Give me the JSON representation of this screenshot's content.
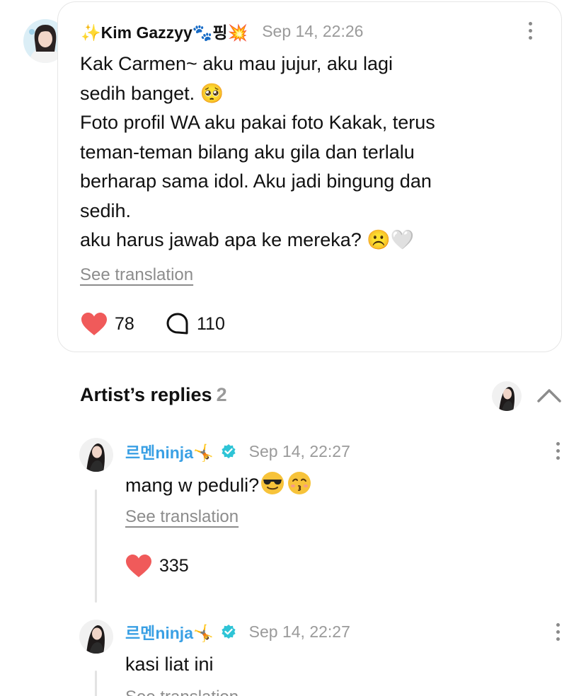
{
  "post": {
    "username": "✨Kim Gazzyy🐾핑💥",
    "timestamp": "Sep 14, 22:26",
    "body": "Kak Carmen~ aku mau jujur, aku lagi\nsedih banget. 🥺\nFoto profil WA aku pakai foto Kakak, terus\nteman-teman bilang aku gila dan terlalu\nberharap sama idol. Aku jadi bingung dan\nsedih.\naku harus jawab apa ke mereka? ☹️🤍",
    "see_translation": "See translation",
    "likes": "78",
    "comments": "110"
  },
  "replies_section": {
    "title": "Artist’s replies",
    "count": "2"
  },
  "replies": [
    {
      "username": "르멘ninja🤸",
      "timestamp": "Sep 14, 22:27",
      "text": "mang w peduli?",
      "see_translation": "See translation",
      "likes": "335"
    },
    {
      "username": "르멘ninja🤸",
      "timestamp": "Sep 14, 22:27",
      "text": "kasi liat ini",
      "see_translation": "See translation"
    }
  ],
  "icons": {
    "more": "more-vertical-icon",
    "like": "heart-icon",
    "comment": "comment-bubble-icon",
    "verified": "verified-badge-icon",
    "collapse": "chevron-up-icon"
  },
  "colors": {
    "heart": "#f05a5a",
    "artist_name": "#3aa0e4",
    "verified": "#2ec4d6",
    "muted": "#9a9a9a"
  }
}
